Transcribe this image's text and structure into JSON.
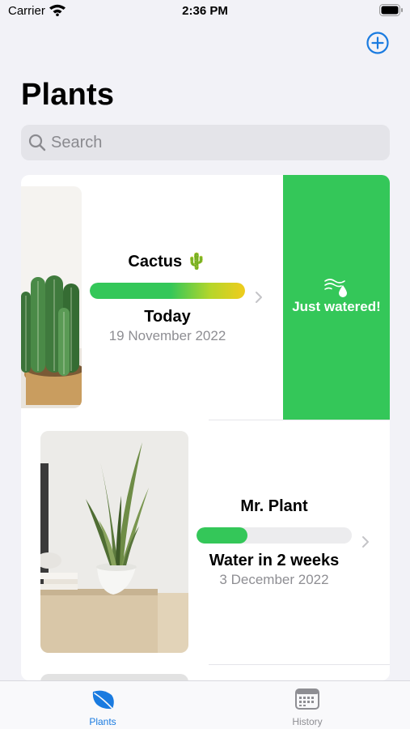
{
  "status_bar": {
    "carrier": "Carrier",
    "time": "2:36 PM"
  },
  "header": {
    "title": "Plants",
    "add_icon": "plus-circle-icon"
  },
  "search": {
    "placeholder": "Search"
  },
  "plants": [
    {
      "name": "Cactus 🌵",
      "status": "Today",
      "date": "19 November 2022",
      "progress": 1.0,
      "swipe_action": {
        "label": "Just watered!",
        "icon": "water-drop-wind-icon",
        "color": "#34c759"
      }
    },
    {
      "name": "Mr. Plant",
      "status": "Water in 2 weeks",
      "date": "3 December 2022",
      "progress": 0.33
    }
  ],
  "tabs": [
    {
      "label": "Plants",
      "icon": "leaf-icon",
      "selected": true
    },
    {
      "label": "History",
      "icon": "calendar-icon",
      "selected": false
    }
  ],
  "colors": {
    "accent": "#1a7be0",
    "progress_green": "#34c759",
    "progress_yellow": "#f0cc1c"
  }
}
